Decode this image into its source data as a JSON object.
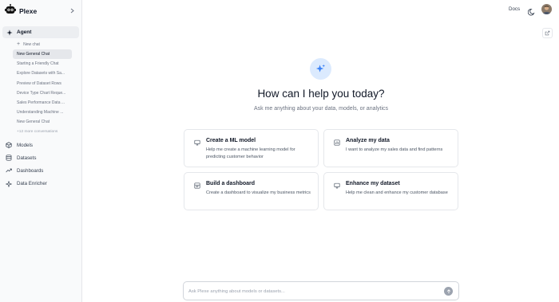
{
  "app": {
    "name": "Plexe"
  },
  "sidebar": {
    "agent_label": "Agent",
    "new_chat_label": "New chat",
    "conversations": [
      "New General Chat",
      "Starting a Friendly Chat",
      "Explore Datasets with Sa...",
      "Preview of Dataset Rows",
      "Device Type Chart Reque...",
      "Sales Performance Data ...",
      "Understanding Machine ...",
      "New General Chat"
    ],
    "more_label": "+12 more conversations",
    "nav": [
      {
        "label": "Models",
        "icon": "cube-icon"
      },
      {
        "label": "Datasets",
        "icon": "database-icon"
      },
      {
        "label": "Dashboards",
        "icon": "trend-icon"
      },
      {
        "label": "Data Enricher",
        "icon": "sparkle-icon"
      }
    ]
  },
  "header": {
    "docs_label": "Docs"
  },
  "hero": {
    "title": "How can I help you today?",
    "subtitle": "Ask me anything about your data, models, or analytics"
  },
  "cards": [
    {
      "title": "Create a ML model",
      "desc": "Help me create a machine learning model for predicting customer behavior",
      "icon": "cube-icon"
    },
    {
      "title": "Analyze my data",
      "desc": "I want to analyze my sales data and find patterns",
      "icon": "bar-chart-icon"
    },
    {
      "title": "Build a dashboard",
      "desc": "Create a dashboard to visualize my business metrics",
      "icon": "dashboard-icon"
    },
    {
      "title": "Enhance my dataset",
      "desc": "Help me clean and enhance my customer database",
      "icon": "database-icon"
    }
  ],
  "chat": {
    "placeholder": "Ask Plexe anything about models or datasets..."
  },
  "colors": {
    "accent": "#3b82f6",
    "accent_soft": "#dbeafe",
    "sidebar_bg": "#f9fafb"
  }
}
